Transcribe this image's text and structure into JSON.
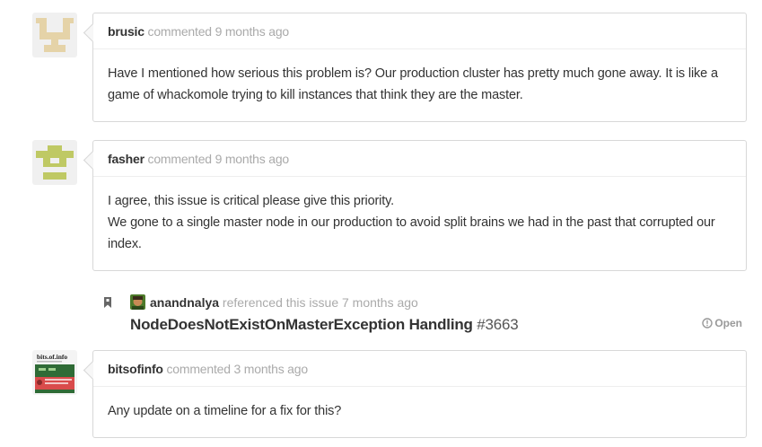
{
  "comments": [
    {
      "author": "brusic",
      "meta": "commented 9 months ago",
      "paragraphs": [
        "Have I mentioned how serious this problem is? Our production cluster has pretty much gone away. It is like a game of whackomole trying to kill instances that think they are the master."
      ]
    },
    {
      "author": "fasher",
      "meta": "commented 9 months ago",
      "paragraphs": [
        "I agree, this issue is critical please give this priority.",
        "We gone to a single master node in our production to avoid split brains we had in the past that corrupted our index."
      ]
    },
    {
      "author": "bitsofinfo",
      "meta": "commented 3 months ago",
      "paragraphs": [
        "Any update on a timeline for a fix for this?"
      ]
    }
  ],
  "reference": {
    "user": "anandnalya",
    "meta": "referenced this issue 7 months ago",
    "title": "NodeDoesNotExistOnMasterException Handling",
    "number": "#3663",
    "state": "Open"
  },
  "avatars": {
    "bitsofinfo_text": "bits.of.info"
  },
  "colors": {
    "brusic_avatar": "#e5d3a8",
    "fasher_avatar": "#bfc964",
    "bitsofinfo_avatar": "#2f6b36"
  }
}
